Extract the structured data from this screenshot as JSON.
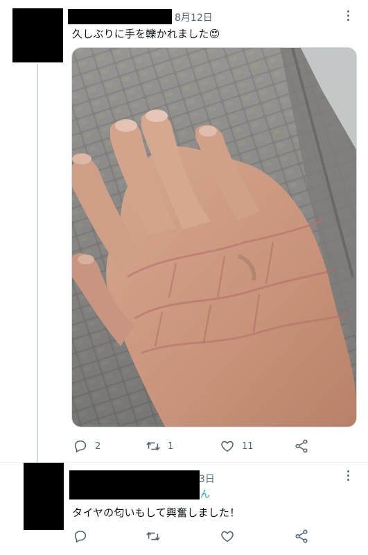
{
  "tweet": {
    "date": "8月12日",
    "text": "久しぶりに手を轢かれました",
    "emoji": "😍",
    "actions": {
      "reply_count": "2",
      "retweet_count": "1",
      "like_count": "11"
    }
  },
  "reply": {
    "date_partial": "3日",
    "handle_partial": "ん",
    "text": "タイヤの匂いもして興奮しました！"
  },
  "icons": {
    "more": "more-icon",
    "reply": "reply-icon",
    "retweet": "retweet-icon",
    "like": "heart-icon",
    "share": "share-icon"
  },
  "colors": {
    "icon_gray": "#536471",
    "link_blue": "#1d9bf0",
    "thread_line": "#cfd9de"
  }
}
